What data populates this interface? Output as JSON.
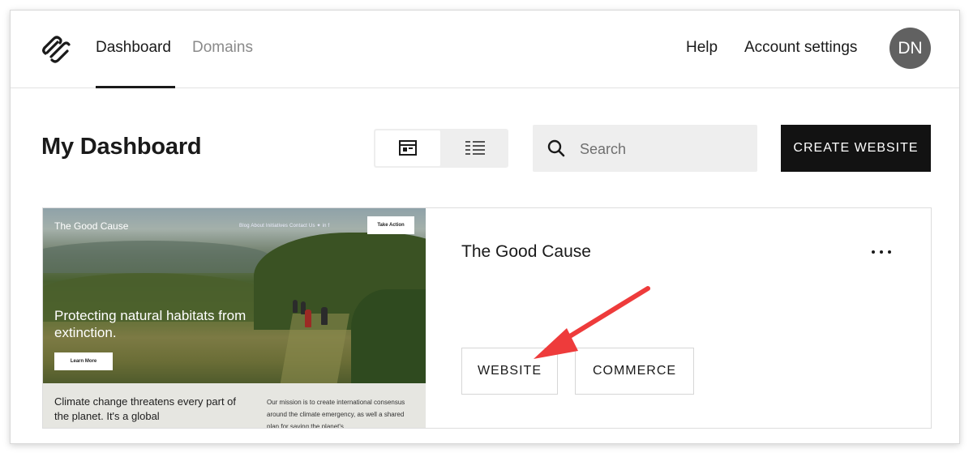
{
  "header": {
    "nav": [
      {
        "label": "Dashboard",
        "active": true
      },
      {
        "label": "Domains",
        "active": false
      }
    ],
    "help": "Help",
    "account_settings": "Account settings",
    "avatar_initials": "DN"
  },
  "main": {
    "title": "My Dashboard",
    "search_placeholder": "Search",
    "create_button": "CREATE WEBSITE"
  },
  "site": {
    "name": "The Good Cause",
    "thumbnail": {
      "site_title": "The Good Cause",
      "nav": "Blog   About   Initiatives   Contact Us   ✦  in  f",
      "cta": "Take Action",
      "headline": "Protecting natural habitats from extinction.",
      "learn_more": "Learn More",
      "body_left": "Climate change threatens every part of the planet. It's a global",
      "body_right": "Our mission is to create international consensus around the climate emergency, as well a shared plan for saving the planet's"
    },
    "buttons": {
      "website": "WEBSITE",
      "commerce": "COMMERCE"
    }
  },
  "colors": {
    "accent_arrow": "#ee3b3b",
    "create_bg": "#121212",
    "avatar_bg": "#616161"
  },
  "icons": [
    "squarespace-logo",
    "grid-view-icon",
    "list-view-icon",
    "search-icon",
    "more-icon",
    "annotation-arrow"
  ]
}
